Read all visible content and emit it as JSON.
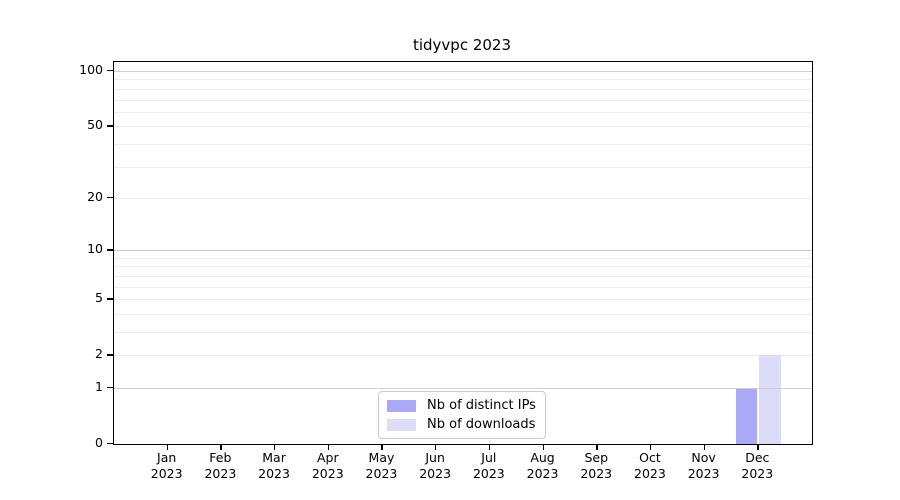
{
  "chart_data": {
    "type": "bar",
    "title": "tidyvpc 2023",
    "categories": [
      "Jan",
      "Feb",
      "Mar",
      "Apr",
      "May",
      "Jun",
      "Jul",
      "Aug",
      "Sep",
      "Oct",
      "Nov",
      "Dec"
    ],
    "category_year": "2023",
    "series": [
      {
        "name": "Nb of distinct IPs",
        "color": "#a9a9f7",
        "values": [
          0,
          0,
          0,
          0,
          0,
          0,
          0,
          0,
          0,
          0,
          0,
          1
        ]
      },
      {
        "name": "Nb of downloads",
        "color": "#dcdcf8",
        "values": [
          0,
          0,
          0,
          0,
          0,
          0,
          0,
          0,
          0,
          0,
          0,
          2
        ]
      }
    ],
    "xlabel": "",
    "ylabel": "",
    "y_scale": "log1p",
    "y_ticks": [
      0,
      1,
      2,
      5,
      10,
      20,
      50,
      100
    ],
    "y_major_gridlines": [
      1,
      10,
      100
    ],
    "y_minor_gridlines": [
      2,
      3,
      4,
      5,
      6,
      7,
      8,
      9,
      20,
      30,
      40,
      50,
      60,
      70,
      80,
      90
    ],
    "ylim": [
      0,
      112
    ],
    "grid": true,
    "legend_position": "bottom-center",
    "colors": {
      "major_grid": "#cfcfcf",
      "minor_grid": "#ececec",
      "axis": "#000000",
      "background": "#ffffff"
    }
  }
}
